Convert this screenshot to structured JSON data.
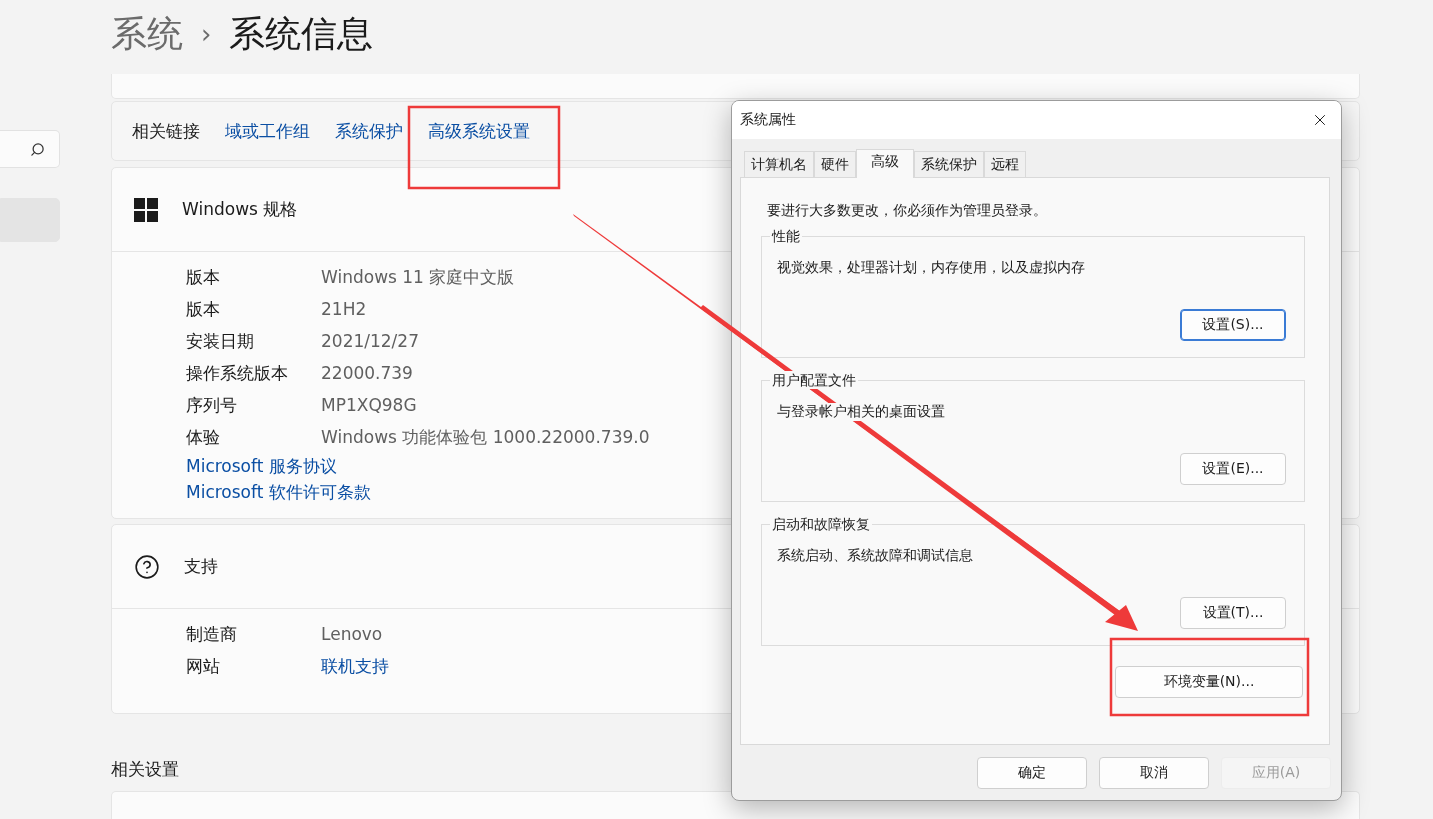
{
  "breadcrumb": {
    "parent": "系统",
    "separator": "›",
    "current": "系统信息"
  },
  "sidebar": {
    "items": [
      {
        "selected": true
      }
    ]
  },
  "related_links": {
    "label": "相关链接",
    "links": [
      "域或工作组",
      "系统保护",
      "高级系统设置"
    ]
  },
  "windows_spec": {
    "title": "Windows 规格",
    "rows": [
      {
        "label": "版本",
        "value": "Windows 11 家庭中文版"
      },
      {
        "label": "版本",
        "value": "21H2"
      },
      {
        "label": "安装日期",
        "value": "2021/12/27"
      },
      {
        "label": "操作系统版本",
        "value": "22000.739"
      },
      {
        "label": "序列号",
        "value": "MP1XQ98G"
      },
      {
        "label": "体验",
        "value": "Windows 功能体验包 1000.22000.739.0"
      }
    ],
    "links": [
      "Microsoft 服务协议",
      "Microsoft 软件许可条款"
    ]
  },
  "support": {
    "title": "支持",
    "rows": [
      {
        "label": "制造商",
        "value": "Lenovo",
        "kind": "text"
      },
      {
        "label": "网站",
        "value": "联机支持",
        "kind": "link"
      }
    ]
  },
  "related_settings": {
    "title": "相关设置"
  },
  "dialog": {
    "title": "系统属性",
    "tabs": [
      {
        "label": "计算机名",
        "selected": false
      },
      {
        "label": "硬件",
        "selected": false
      },
      {
        "label": "高级",
        "selected": true
      },
      {
        "label": "系统保护",
        "selected": false
      },
      {
        "label": "远程",
        "selected": false
      }
    ],
    "notice": "要进行大多数更改，你必须作为管理员登录。",
    "groups": [
      {
        "title": "性能",
        "description": "视觉效果，处理器计划，内存使用，以及虚拟内存",
        "button": "设置(S)...",
        "focused": true
      },
      {
        "title": "用户配置文件",
        "description": "与登录帐户相关的桌面设置",
        "button": "设置(E)...",
        "focused": false
      },
      {
        "title": "启动和故障恢复",
        "description": "系统启动、系统故障和调试信息",
        "button": "设置(T)...",
        "focused": false
      }
    ],
    "env_button": "环境变量(N)...",
    "buttons": [
      {
        "label": "确定",
        "disabled": false
      },
      {
        "label": "取消",
        "disabled": false
      },
      {
        "label": "应用(A)",
        "disabled": true
      }
    ]
  }
}
